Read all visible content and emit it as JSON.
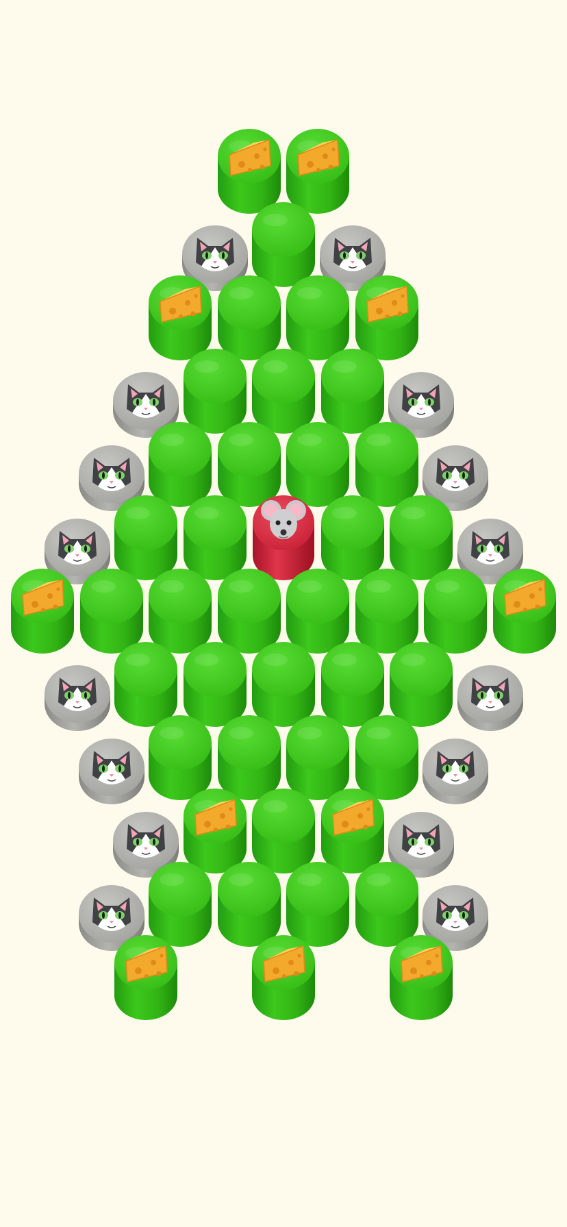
{
  "board": {
    "colors": {
      "background": "#fffbec",
      "block_green": "#3ec21c",
      "block_green_dark": "#1f8a0c",
      "player_red": "#d8283c",
      "cat_stone_gray": "#a8a8a6"
    },
    "rows": [
      [
        "empty",
        "empty",
        "empty",
        "cheese",
        "cheese",
        "empty",
        "empty",
        "empty"
      ],
      [
        "empty",
        "empty",
        "cat",
        "green",
        "cat",
        "empty",
        "empty"
      ],
      [
        "empty",
        "empty",
        "cheese",
        "green",
        "green",
        "cheese",
        "empty",
        "empty"
      ],
      [
        "empty",
        "cat",
        "green",
        "green",
        "green",
        "cat",
        "empty"
      ],
      [
        "empty",
        "cat",
        "green",
        "green",
        "green",
        "green",
        "cat",
        "empty"
      ],
      [
        "cat",
        "green",
        "green",
        "mouse",
        "green",
        "green",
        "cat"
      ],
      [
        "cheese",
        "green",
        "green",
        "green",
        "green",
        "green",
        "green",
        "cheese"
      ],
      [
        "cat",
        "green",
        "green",
        "green",
        "green",
        "green",
        "cat"
      ],
      [
        "empty",
        "cat",
        "green",
        "green",
        "green",
        "green",
        "cat",
        "empty"
      ],
      [
        "empty",
        "cat",
        "cheese",
        "green",
        "cheese",
        "cat",
        "empty"
      ],
      [
        "empty",
        "cat",
        "green",
        "green",
        "green",
        "green",
        "cat",
        "empty"
      ],
      [
        "empty",
        "cheese",
        "empty",
        "cheese",
        "empty",
        "cheese",
        "empty"
      ]
    ]
  },
  "icons": {
    "green": "green-block",
    "cheese": "cheese-icon",
    "cat": "cat-face-icon",
    "mouse": "mouse-face-icon"
  }
}
